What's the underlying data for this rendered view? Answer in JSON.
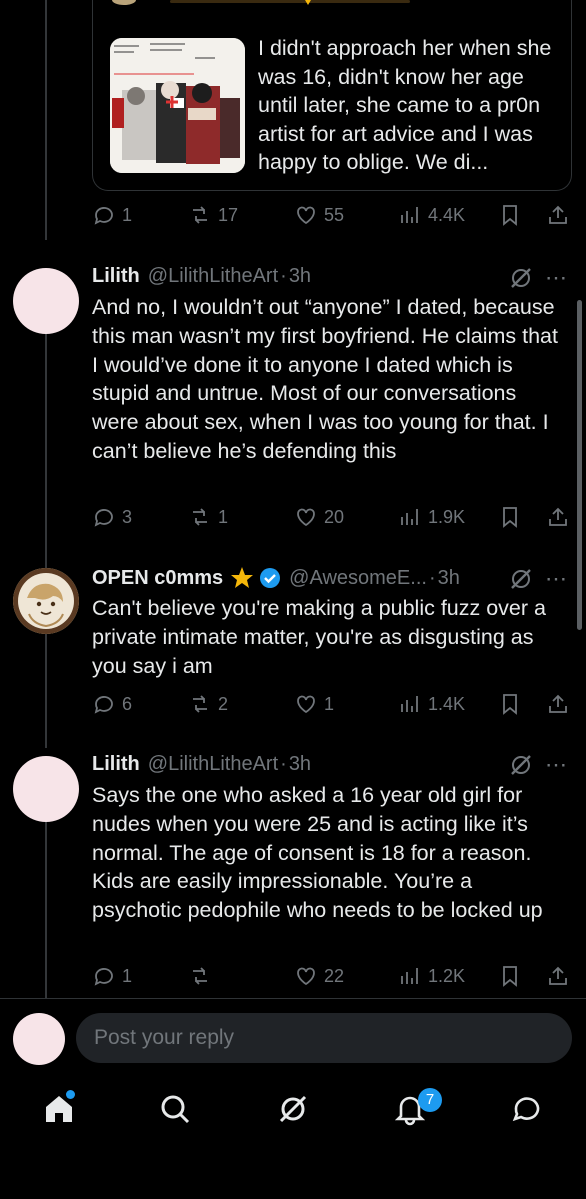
{
  "quote": {
    "text": "I didn't approach her when she was 16, didn't know her age until later, she came to a pr0n artist for art advice and I was happy to oblige. We di..."
  },
  "quote_actions": {
    "replies": "1",
    "reposts": "17",
    "likes": "55",
    "views": "4.4K"
  },
  "tweets": [
    {
      "name": "Lilith",
      "handle": "@LilithLitheArt",
      "time": "3h",
      "text": "And no, I wouldn’t out “anyone” I dated, because this man wasn’t my first boyfriend. He claims that I would’ve done it to anyone I dated which is stupid and untrue. Most of our conversations were about sex, when I was too young for that. I can’t believe he’s defending this",
      "replies": "3",
      "reposts": "1",
      "likes": "20",
      "views": "1.9K"
    },
    {
      "name": "OPEN c0mms",
      "handle": "@AwesomeE...",
      "time": "3h",
      "text": "Can't believe you're making a public fuzz over a private intimate matter, you're as disgusting as you say i am",
      "replies": "6",
      "reposts": "2",
      "likes": "1",
      "views": "1.4K"
    },
    {
      "name": "Lilith",
      "handle": "@LilithLitheArt",
      "time": "3h",
      "text": "Says the one who asked a 16 year old girl for nudes when you were 25 and is acting like it’s normal. The age of consent is 18 for a reason. Kids are easily impressionable. You’re a psychotic pedophile who needs to be locked up",
      "replies": "1",
      "reposts": "",
      "likes": "22",
      "views": "1.2K"
    }
  ],
  "separator": "·",
  "reply": {
    "placeholder": "Post your reply"
  },
  "nav": {
    "notifications_count": "7"
  },
  "colors": {
    "accent": "#1d9bf0",
    "muted": "#71767b",
    "text": "#e7e9ea",
    "background": "#000000",
    "verified": "#1d9bf0",
    "star": "#f5b70a"
  }
}
